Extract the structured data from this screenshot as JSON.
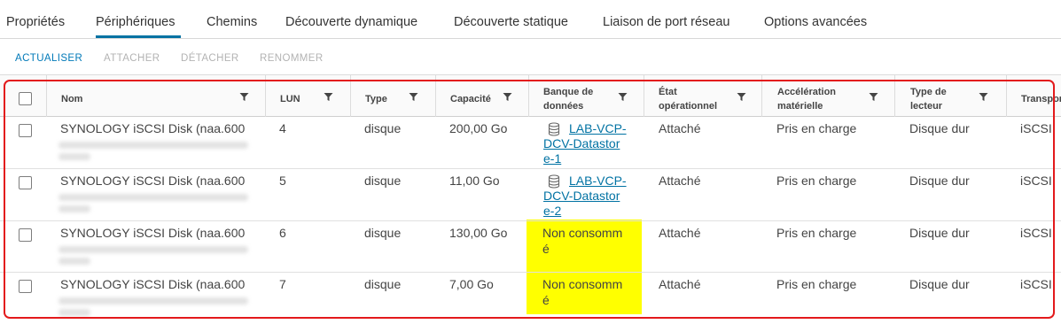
{
  "tabs": [
    {
      "label": "Propriétés"
    },
    {
      "label": "Périphériques",
      "active": true
    },
    {
      "label": "Chemins"
    },
    {
      "label": "Découverte dynamique"
    },
    {
      "label": "Découverte statique"
    },
    {
      "label": "Liaison de port réseau"
    },
    {
      "label": "Options avancées"
    }
  ],
  "toolbar": {
    "refresh": "ACTUALISER",
    "attach": "ATTACHER",
    "detach": "DÉTACHER",
    "rename": "RENOMMER"
  },
  "columns": {
    "name": "Nom",
    "lun": "LUN",
    "type": "Type",
    "capacity": "Capacité",
    "datastore_1": "Banque de",
    "datastore_2": "données",
    "state_1": "État",
    "state_2": "opérationnel",
    "accel_1": "Accélération",
    "accel_2": "matérielle",
    "drive_1": "Type de",
    "drive_2": "lecteur",
    "transport": "Transpor"
  },
  "rows": [
    {
      "name": "SYNOLOGY iSCSI Disk (naa.600",
      "lun": "4",
      "type": "disque",
      "capacity": "200,00 Go",
      "datastore_l1": "LAB-VCP-",
      "datastore_l2": "DCV-Datastor",
      "datastore_l3": "e-1",
      "state": "Attaché",
      "accel": "Pris en charge",
      "drive": "Disque dur",
      "transport": "iSCSI"
    },
    {
      "name": "SYNOLOGY iSCSI Disk (naa.600",
      "lun": "5",
      "type": "disque",
      "capacity": "11,00 Go",
      "datastore_l1": "LAB-VCP-",
      "datastore_l2": "DCV-Datastor",
      "datastore_l3": "e-2",
      "state": "Attaché",
      "accel": "Pris en charge",
      "drive": "Disque dur",
      "transport": "iSCSI"
    },
    {
      "name": "SYNOLOGY iSCSI Disk (naa.600",
      "lun": "6",
      "type": "disque",
      "capacity": "130,00 Go",
      "datastore_l1": "Non consomm",
      "datastore_l2": "é",
      "state": "Attaché",
      "accel": "Pris en charge",
      "drive": "Disque dur",
      "transport": "iSCSI"
    },
    {
      "name": "SYNOLOGY iSCSI Disk (naa.600",
      "lun": "7",
      "type": "disque",
      "capacity": "7,00 Go",
      "datastore_l1": "Non consomm",
      "datastore_l2": "é",
      "state": "Attaché",
      "accel": "Pris en charge",
      "drive": "Disque dur",
      "transport": "iSCSI"
    }
  ],
  "colors": {
    "accent": "#0072a3",
    "highlight": "#ffff00",
    "annotation": "#e31a1c"
  },
  "icons": {
    "filter": "filter-icon",
    "datastore": "datastore-icon"
  }
}
